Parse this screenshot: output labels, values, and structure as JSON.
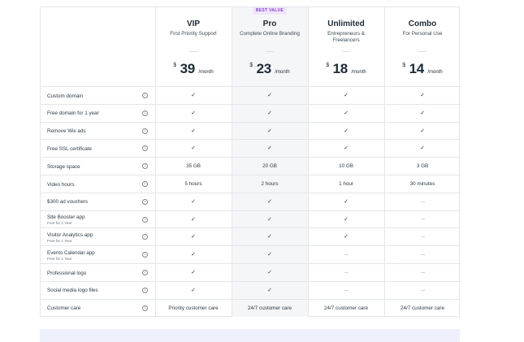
{
  "plans": [
    {
      "badge": "",
      "name": "VIP",
      "tagline": "First Priority Support",
      "currency": "$",
      "price": "39",
      "period": "/month"
    },
    {
      "badge": "BEST VALUE",
      "name": "Pro",
      "tagline": "Complete Online Branding",
      "currency": "$",
      "price": "23",
      "period": "/month"
    },
    {
      "badge": "",
      "name": "Unlimited",
      "tagline": "Entrepreneurs & Freelancers",
      "currency": "$",
      "price": "18",
      "period": "/month"
    },
    {
      "badge": "",
      "name": "Combo",
      "tagline": "For Personal Use",
      "currency": "$",
      "price": "14",
      "period": "/month"
    }
  ],
  "info_glyph": "i",
  "check_glyph": "✓",
  "features": [
    {
      "label": "Custom domain",
      "sub": "",
      "values": [
        "✓",
        "✓",
        "✓",
        "✓"
      ]
    },
    {
      "label": "Free domain for 1 year",
      "sub": "",
      "values": [
        "✓",
        "✓",
        "✓",
        "✓"
      ]
    },
    {
      "label": "Remove Wix ads",
      "sub": "",
      "values": [
        "✓",
        "✓",
        "✓",
        "✓"
      ]
    },
    {
      "label": "Free SSL certificate",
      "sub": "",
      "values": [
        "✓",
        "✓",
        "✓",
        "✓"
      ]
    },
    {
      "label": "Storage space",
      "sub": "",
      "values": [
        "35 GB",
        "20 GB",
        "10 GB",
        "3 GB"
      ]
    },
    {
      "label": "Video hours",
      "sub": "",
      "values": [
        "5 hours",
        "2 hours",
        "1 hour",
        "30 minutes"
      ]
    },
    {
      "label": "$300 ad vouchers",
      "sub": "",
      "values": [
        "✓",
        "✓",
        "✓",
        "-"
      ]
    },
    {
      "label": "Site Booster app",
      "sub": "Free for 1 Year",
      "values": [
        "✓",
        "✓",
        "✓",
        "-"
      ]
    },
    {
      "label": "Visitor Analytics app",
      "sub": "Free for 1 Year",
      "values": [
        "✓",
        "✓",
        "✓",
        "-"
      ]
    },
    {
      "label": "Events Calendar app",
      "sub": "Free for 1 Year",
      "values": [
        "✓",
        "✓",
        "-",
        "-"
      ]
    },
    {
      "label": "Professional logo",
      "sub": "",
      "values": [
        "✓",
        "✓",
        "-",
        "-"
      ]
    },
    {
      "label": "Social media logo files",
      "sub": "",
      "values": [
        "✓",
        "✓",
        "-",
        "-"
      ]
    },
    {
      "label": "Customer care",
      "sub": "",
      "values": [
        "Priority customer care",
        "24/7 customer care",
        "24/7 customer care",
        "24/7 customer care"
      ]
    }
  ]
}
